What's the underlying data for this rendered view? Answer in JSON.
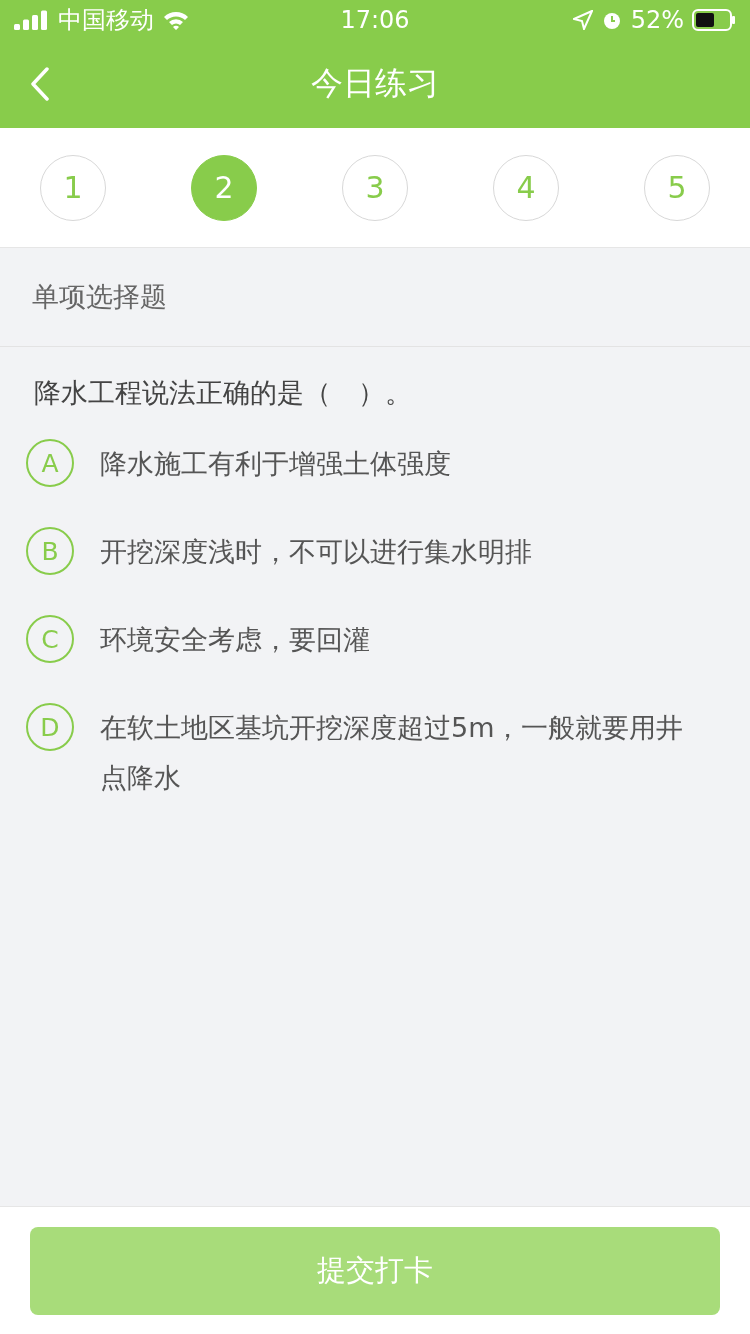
{
  "status_bar": {
    "carrier": "中国移动",
    "time": "17:06",
    "battery": "52%"
  },
  "nav": {
    "title": "今日练习"
  },
  "steps": [
    {
      "label": "1",
      "selected": false
    },
    {
      "label": "2",
      "selected": true
    },
    {
      "label": "3",
      "selected": false
    },
    {
      "label": "4",
      "selected": false
    },
    {
      "label": "5",
      "selected": false
    }
  ],
  "section": "单项选择题",
  "question": "降水工程说法正确的是（　）。",
  "options": [
    {
      "letter": "A",
      "text": "降水施工有利于增强土体强度",
      "selected": false
    },
    {
      "letter": "B",
      "text": "开挖深度浅时，不可以进行集水明排",
      "selected": false
    },
    {
      "letter": "C",
      "text": "环境安全考虑，要回灌",
      "selected": false
    },
    {
      "letter": "D",
      "text": "在软土地区基坑开挖深度超过5m，一般就要用井点降水",
      "selected": false
    }
  ],
  "submit": {
    "label": "提交打卡",
    "disabled": true
  }
}
